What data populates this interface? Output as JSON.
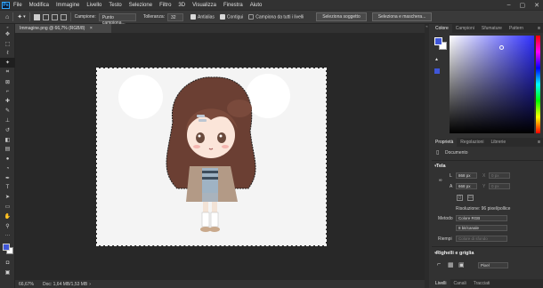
{
  "menu": [
    "File",
    "Modifica",
    "Immagine",
    "Livello",
    "Testo",
    "Selezione",
    "Filtro",
    "3D",
    "Visualizza",
    "Finestra",
    "Aiuto"
  ],
  "options": {
    "campione_label": "Campione:",
    "campione_value": "Punto campiona...",
    "tolleranza_label": "Tolleranza:",
    "tolleranza_value": "32",
    "antialias": "Antialias",
    "contigui": "Contigui",
    "tutti_livelli": "Campiona da tutti i livelli",
    "seleziona_soggetto": "Seleziona soggetto",
    "seleziona_maschera": "Seleziona e maschera..."
  },
  "document": {
    "tab_title": "Immagine.png @ 66,7% (RGB/8)",
    "close": "×"
  },
  "status": {
    "zoom": "66,67%",
    "doc": "Doc: 1,64 MB/1,53 MB"
  },
  "color_panel": {
    "tabs": [
      "Colore",
      "Campioni",
      "Sfumature",
      "Pattern"
    ],
    "fg": "#3f56d8",
    "bg": "#ffffff"
  },
  "properties": {
    "tabs": [
      "Proprietà",
      "Regolazioni",
      "Librerie"
    ],
    "doc_label": "Documento",
    "tela": "Tela",
    "w_label": "L",
    "w_value": "868 px",
    "x_label": "X",
    "x_value": "0 px",
    "h_label": "A",
    "h_value": "668 px",
    "y_label": "Y",
    "y_value": "0 px",
    "risoluzione": "Risoluzione: 96 pixel/pollice",
    "metodo_label": "Metodo",
    "metodo_value": "Colore RGB",
    "bit_value": "8 bit/canale",
    "riempi_label": "Riempi",
    "riempi_value": "Colore di sfondo",
    "righelli": "Righelli e griglia",
    "unit": "Pixel"
  },
  "layers_tabs": [
    "Livelli",
    "Canali",
    "Tracciati"
  ],
  "colors": {
    "accent": "#31a8ff",
    "canvas_bg": "#282828",
    "panel": "#323232"
  }
}
